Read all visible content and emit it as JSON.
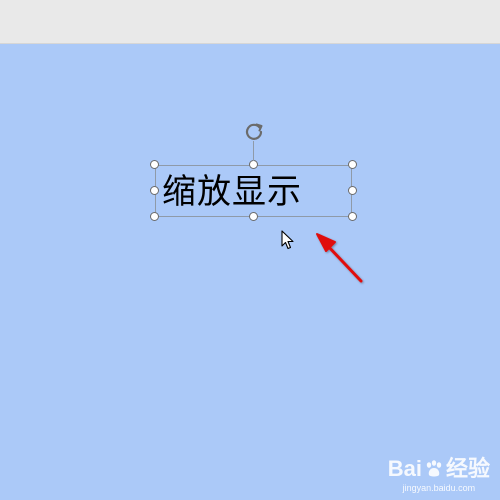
{
  "textbox": {
    "text": "缩放显示"
  },
  "watermark": {
    "brand_left": "Bai",
    "brand_right": "经验",
    "url": "jingyan.baidu.com"
  },
  "icons": {
    "rotate": "rotate-handle-icon",
    "cursor": "mouse-pointer-icon",
    "annotation": "red-arrow-icon",
    "paw": "baidu-paw-icon"
  },
  "colors": {
    "canvas": "#abc9f8",
    "topbar": "#e9e9e9",
    "arrow": "#e01010"
  }
}
